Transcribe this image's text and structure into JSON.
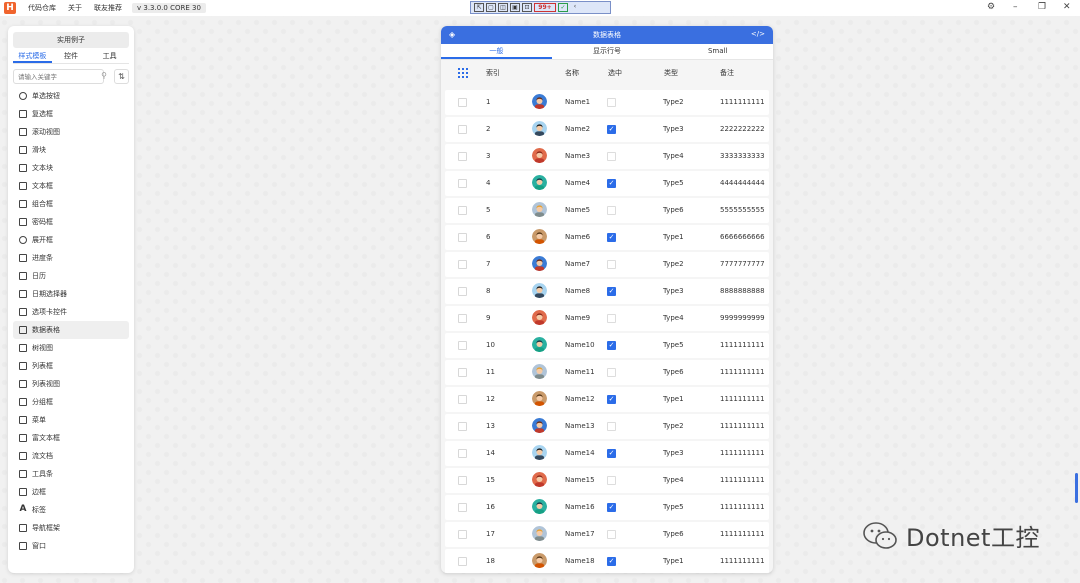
{
  "titlebar": {
    "logo": "H",
    "menu": [
      "代码仓库",
      "关于",
      "联友推荐"
    ],
    "version": "v 3.3.0.0 CORE 30",
    "devbar_badge": "99+",
    "settings_icon": "gear-icon"
  },
  "sidebar": {
    "title": "实用例子",
    "tabs": [
      "样式模板",
      "控件",
      "工具"
    ],
    "search_placeholder": "请输入关键字",
    "items": [
      "单选按钮",
      "复选框",
      "滚动视图",
      "滑块",
      "文本块",
      "文本框",
      "组合框",
      "密码框",
      "展开框",
      "进度条",
      "日历",
      "日期选择器",
      "选项卡控件",
      "数据表格",
      "树视图",
      "列表框",
      "列表视图",
      "分组框",
      "菜单",
      "富文本框",
      "流文档",
      "工具条",
      "边框",
      "标签",
      "导航框架",
      "窗口"
    ],
    "active_item": "数据表格"
  },
  "card": {
    "title": "数据表格",
    "code_icon": "</>",
    "tabs": [
      "一般",
      "显示行号",
      "Small"
    ],
    "headers": {
      "index": "索引",
      "name": "名称",
      "selected": "选中",
      "type": "类型",
      "note": "备注"
    },
    "rows": [
      {
        "index": "1",
        "name": "Name1",
        "checked": false,
        "type": "Type2",
        "note": "1111111111"
      },
      {
        "index": "2",
        "name": "Name2",
        "checked": true,
        "type": "Type3",
        "note": "2222222222"
      },
      {
        "index": "3",
        "name": "Name3",
        "checked": false,
        "type": "Type4",
        "note": "3333333333"
      },
      {
        "index": "4",
        "name": "Name4",
        "checked": true,
        "type": "Type5",
        "note": "4444444444"
      },
      {
        "index": "5",
        "name": "Name5",
        "checked": false,
        "type": "Type6",
        "note": "5555555555"
      },
      {
        "index": "6",
        "name": "Name6",
        "checked": true,
        "type": "Type1",
        "note": "6666666666"
      },
      {
        "index": "7",
        "name": "Name7",
        "checked": false,
        "type": "Type2",
        "note": "7777777777"
      },
      {
        "index": "8",
        "name": "Name8",
        "checked": true,
        "type": "Type3",
        "note": "8888888888"
      },
      {
        "index": "9",
        "name": "Name9",
        "checked": false,
        "type": "Type4",
        "note": "9999999999"
      },
      {
        "index": "10",
        "name": "Name10",
        "checked": true,
        "type": "Type5",
        "note": "1111111111"
      },
      {
        "index": "11",
        "name": "Name11",
        "checked": false,
        "type": "Type6",
        "note": "1111111111"
      },
      {
        "index": "12",
        "name": "Name12",
        "checked": true,
        "type": "Type1",
        "note": "1111111111"
      },
      {
        "index": "13",
        "name": "Name13",
        "checked": false,
        "type": "Type2",
        "note": "1111111111"
      },
      {
        "index": "14",
        "name": "Name14",
        "checked": true,
        "type": "Type3",
        "note": "1111111111"
      },
      {
        "index": "15",
        "name": "Name15",
        "checked": false,
        "type": "Type4",
        "note": "1111111111"
      },
      {
        "index": "16",
        "name": "Name16",
        "checked": true,
        "type": "Type5",
        "note": "1111111111"
      },
      {
        "index": "17",
        "name": "Name17",
        "checked": false,
        "type": "Type6",
        "note": "1111111111"
      },
      {
        "index": "18",
        "name": "Name18",
        "checked": true,
        "type": "Type1",
        "note": "1111111111"
      }
    ]
  },
  "watermark": {
    "text": "Dotnet工控"
  },
  "colors": {
    "accent": "#2b6ce8",
    "header": "#3a6fe0"
  }
}
